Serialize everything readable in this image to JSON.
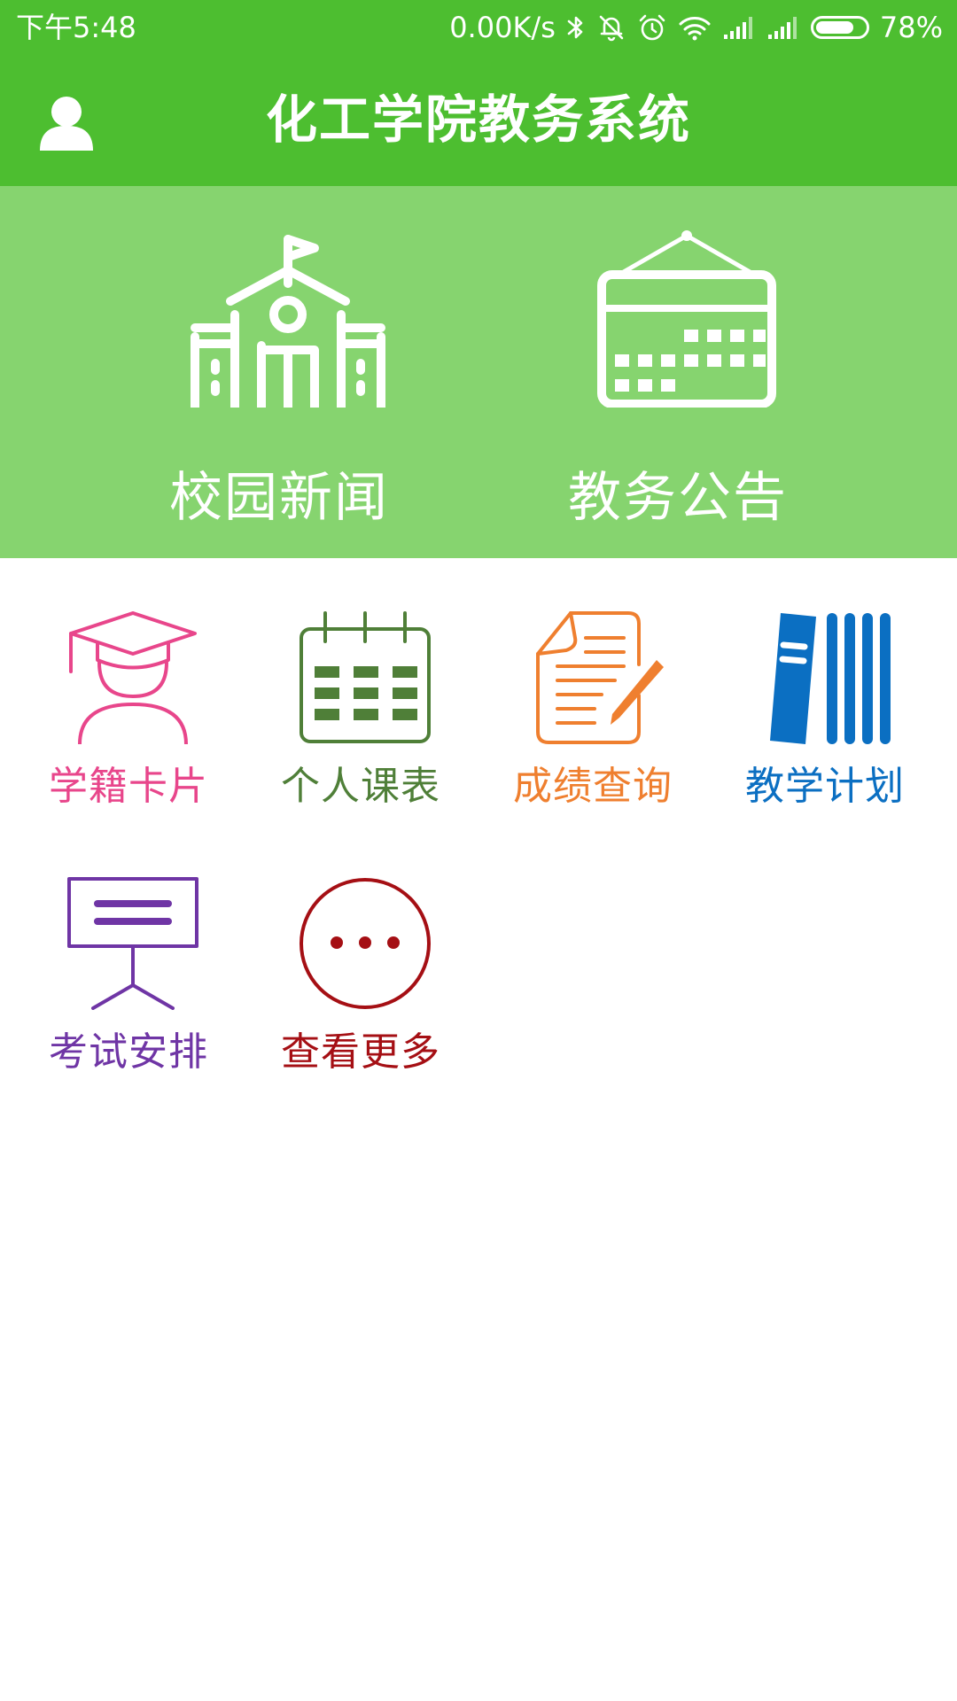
{
  "status_bar": {
    "time": "下午5:48",
    "network_speed": "0.00K/s",
    "battery_percent": "78%",
    "battery_level": 0.78,
    "icons": [
      "bluetooth-icon",
      "mute-icon",
      "alarm-icon",
      "wifi-icon",
      "signal-icon",
      "signal-icon",
      "battery-icon"
    ]
  },
  "app_bar": {
    "title": "化工学院教务系统",
    "user_icon": "user-icon"
  },
  "banner": [
    {
      "label": "校园新闻",
      "icon": "school-building-icon"
    },
    {
      "label": "教务公告",
      "icon": "calendar-board-icon"
    }
  ],
  "menu": [
    {
      "label": "学籍卡片",
      "icon": "graduate-icon",
      "color": "#e8468b"
    },
    {
      "label": "个人课表",
      "icon": "calendar-icon",
      "color": "#4f7f38"
    },
    {
      "label": "成绩查询",
      "icon": "document-pen-icon",
      "color": "#ef7f2f"
    },
    {
      "label": "教学计划",
      "icon": "books-icon",
      "color": "#0b6fc2"
    },
    {
      "label": "考试安排",
      "icon": "presentation-board-icon",
      "color": "#6f35a5"
    },
    {
      "label": "查看更多",
      "icon": "more-icon",
      "color": "#a50f14"
    }
  ],
  "colors": {
    "primary": "#4dbe30",
    "banner_bg": "#86d46f"
  }
}
